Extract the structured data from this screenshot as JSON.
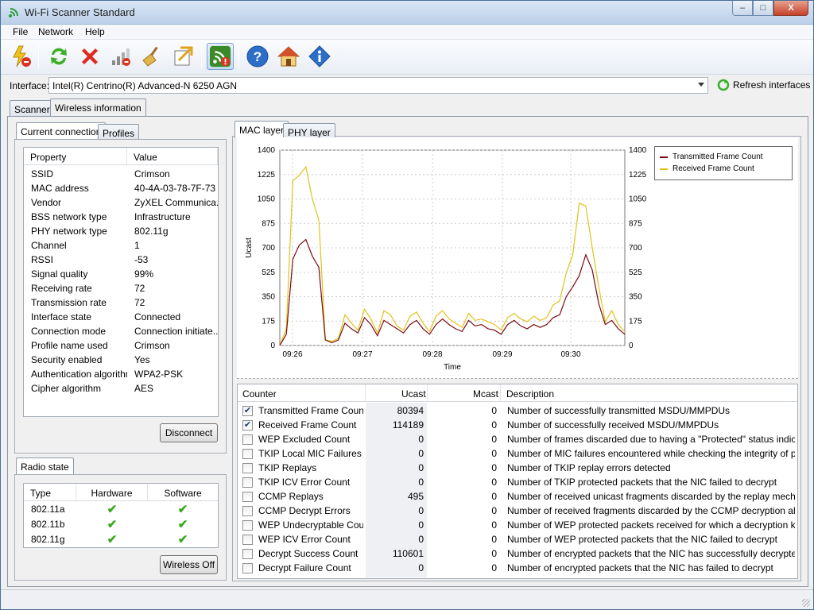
{
  "window": {
    "title": "Wi-Fi Scanner Standard",
    "min": "–",
    "max": "□",
    "close": "X"
  },
  "menu": {
    "file": "File",
    "network": "Network",
    "help": "Help"
  },
  "toolbar": {
    "icons": [
      "stop-scan-icon",
      "refresh-icon",
      "delete-icon",
      "signal-bars-icon",
      "clear-broom-icon",
      "export-icon",
      "wireless-info-icon",
      "help-icon",
      "home-icon",
      "info-icon"
    ]
  },
  "interface": {
    "label": "Interface:",
    "value": "Intel(R) Centrino(R) Advanced-N 6250 AGN",
    "refresh_label": "Refresh interfaces"
  },
  "main_tabs": {
    "scanner": "Scanner",
    "wireless": "Wireless information"
  },
  "left_tabs": {
    "current": "Current connection",
    "profiles": "Profiles"
  },
  "properties": {
    "header_property": "Property",
    "header_value": "Value",
    "rows": [
      {
        "name": "SSID",
        "value": "Crimson"
      },
      {
        "name": "MAC address",
        "value": "40-4A-03-78-7F-73"
      },
      {
        "name": "Vendor",
        "value": "ZyXEL Communica..."
      },
      {
        "name": "BSS network type",
        "value": "Infrastructure"
      },
      {
        "name": "PHY network type",
        "value": "802.11g"
      },
      {
        "name": "Channel",
        "value": "1"
      },
      {
        "name": "RSSI",
        "value": "-53"
      },
      {
        "name": "Signal quality",
        "value": "99%"
      },
      {
        "name": "Receiving rate",
        "value": "72"
      },
      {
        "name": "Transmission rate",
        "value": "72"
      },
      {
        "name": "Interface state",
        "value": "Connected"
      },
      {
        "name": "Connection mode",
        "value": "Connection initiate..."
      },
      {
        "name": "Profile name used",
        "value": "Crimson"
      },
      {
        "name": "Security enabled",
        "value": "Yes"
      },
      {
        "name": "Authentication algorithm",
        "value": "WPA2-PSK"
      },
      {
        "name": "Cipher algorithm",
        "value": "AES"
      }
    ],
    "disconnect": "Disconnect"
  },
  "radio": {
    "tab": "Radio state",
    "header_type": "Type",
    "header_hw": "Hardware",
    "header_sw": "Software",
    "rows": [
      {
        "type": "802.11a"
      },
      {
        "type": "802.11b"
      },
      {
        "type": "802.11g"
      }
    ],
    "check": "✔",
    "wireless_off": "Wireless Off"
  },
  "chart_tabs": {
    "mac": "MAC layer",
    "phy": "PHY layer"
  },
  "chart_data": {
    "type": "line",
    "xlabel": "Time",
    "ylabel": "Ucast",
    "ylim": [
      0,
      1400
    ],
    "yticks": [
      "0",
      "175",
      "350",
      "525",
      "700",
      "875",
      "1050",
      "1225",
      "1400"
    ],
    "xticks": [
      "09:26",
      "09:27",
      "09:28",
      "09:29",
      "09:30"
    ],
    "legend_position": "top-right",
    "series": [
      {
        "name": "Transmitted Frame Count",
        "color": "#7a0a12",
        "values": [
          0,
          80,
          620,
          720,
          760,
          640,
          560,
          40,
          20,
          40,
          160,
          120,
          90,
          200,
          150,
          70,
          180,
          150,
          120,
          90,
          150,
          180,
          120,
          80,
          150,
          190,
          150,
          120,
          100,
          180,
          140,
          150,
          120,
          110,
          80,
          150,
          180,
          140,
          120,
          150,
          130,
          150,
          200,
          220,
          350,
          420,
          500,
          650,
          540,
          300,
          150,
          180,
          120,
          80
        ]
      },
      {
        "name": "Received Frame Count",
        "color": "#e0c21a",
        "values": [
          0,
          120,
          1180,
          1220,
          1280,
          1050,
          900,
          40,
          30,
          50,
          220,
          160,
          110,
          260,
          190,
          90,
          250,
          220,
          140,
          110,
          210,
          240,
          160,
          100,
          210,
          250,
          190,
          160,
          130,
          230,
          180,
          190,
          170,
          150,
          110,
          200,
          230,
          190,
          170,
          210,
          180,
          200,
          290,
          320,
          520,
          650,
          1020,
          1000,
          700,
          420,
          170,
          250,
          150,
          100
        ]
      }
    ]
  },
  "counters": {
    "header_counter": "Counter",
    "header_ucast": "Ucast",
    "header_mcast": "Mcast",
    "header_desc": "Description",
    "check": "✔",
    "rows": [
      {
        "name": "Transmitted Frame Count",
        "checked": true,
        "ucast": "80394",
        "mcast": "0",
        "desc": "Number of successfully transmitted MSDU/MMPDUs"
      },
      {
        "name": "Received Frame Count",
        "checked": true,
        "ucast": "114189",
        "mcast": "0",
        "desc": "Number of successfully received MSDU/MMPDUs"
      },
      {
        "name": "WEP Excluded Count",
        "checked": false,
        "ucast": "0",
        "mcast": "0",
        "desc": "Number of frames discarded due to having a \"Protected\" status indicated i..."
      },
      {
        "name": "TKIP Local MIC Failures",
        "checked": false,
        "ucast": "0",
        "mcast": "0",
        "desc": "Number of MIC failures encountered while checking the integrity of packet..."
      },
      {
        "name": "TKIP Replays",
        "checked": false,
        "ucast": "0",
        "mcast": "0",
        "desc": "Number of TKIP replay errors detected"
      },
      {
        "name": "TKIP ICV Error Count",
        "checked": false,
        "ucast": "0",
        "mcast": "0",
        "desc": "Number of TKIP protected packets that the NIC failed to decrypt"
      },
      {
        "name": "CCMP Replays",
        "checked": false,
        "ucast": "495",
        "mcast": "0",
        "desc": "Number of received unicast fragments discarded by the replay mechanism"
      },
      {
        "name": "CCMP Decrypt Errors",
        "checked": false,
        "ucast": "0",
        "mcast": "0",
        "desc": "Number of received fragments discarded by the CCMP decryption algorithm"
      },
      {
        "name": "WEP Undecryptable Count",
        "checked": false,
        "ucast": "0",
        "mcast": "0",
        "desc": "Number of WEP protected packets received for which a decryption key w..."
      },
      {
        "name": "WEP ICV Error Count",
        "checked": false,
        "ucast": "0",
        "mcast": "0",
        "desc": "Number of WEP protected packets that the NIC failed to decrypt"
      },
      {
        "name": "Decrypt Success Count",
        "checked": false,
        "ucast": "110601",
        "mcast": "0",
        "desc": "Number of encrypted packets that the NIC has successfully decrypted"
      },
      {
        "name": "Decrypt Failure Count",
        "checked": false,
        "ucast": "0",
        "mcast": "0",
        "desc": "Number of encrypted packets that the NIC has failed to decrypt"
      }
    ]
  }
}
